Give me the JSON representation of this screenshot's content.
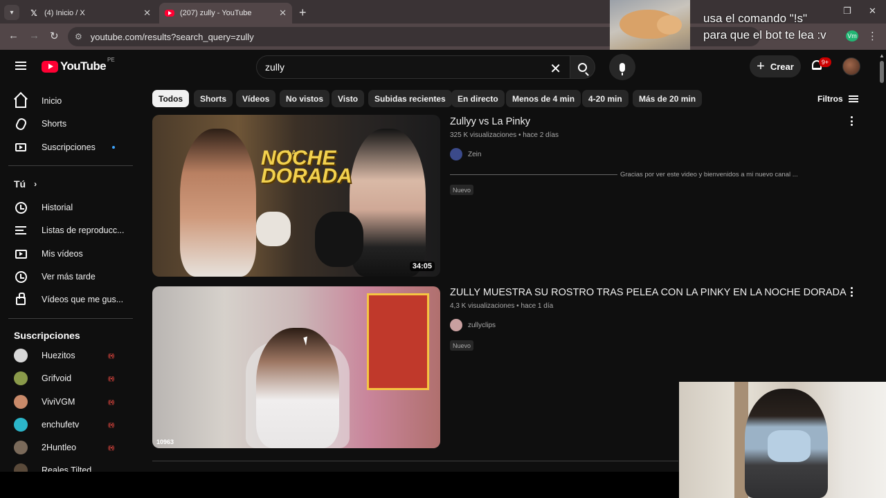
{
  "browser": {
    "tabs": [
      {
        "title": "(4) Inicio / X",
        "favicon": "x-icon",
        "active": false
      },
      {
        "title": "(207) zully - YouTube",
        "favicon": "youtube-icon",
        "active": true
      }
    ],
    "url": "youtube.com/results?search_query=zully"
  },
  "stream_overlay": {
    "text": "usa el comando \"!s\"\npara que el bot te lea :v",
    "badge": "Vm"
  },
  "header": {
    "logo_text": "YouTube",
    "country_code": "PE",
    "search_value": "zully",
    "create_label": "Crear",
    "notification_count": "9+"
  },
  "sidebar": {
    "main": [
      {
        "label": "Inicio",
        "icon": "home-icon"
      },
      {
        "label": "Shorts",
        "icon": "shorts-icon"
      },
      {
        "label": "Suscripciones",
        "icon": "subscriptions-icon"
      }
    ],
    "you_heading": "Tú",
    "you_items": [
      {
        "label": "Historial",
        "icon": "history-icon"
      },
      {
        "label": "Listas de reproducc...",
        "icon": "playlists-icon"
      },
      {
        "label": "Mis vídeos",
        "icon": "my-videos-icon"
      },
      {
        "label": "Ver más tarde",
        "icon": "watch-later-icon"
      },
      {
        "label": "Vídeos que me gus...",
        "icon": "liked-icon"
      }
    ],
    "subscriptions_heading": "Suscripciones",
    "subscriptions": [
      {
        "name": "Huezitos",
        "color": "#d8d8d8"
      },
      {
        "name": "Grifvoid",
        "color": "#8a9a4a"
      },
      {
        "name": "ViviVGM",
        "color": "#c98a6a"
      },
      {
        "name": "enchufetv",
        "color": "#2bb5c9"
      },
      {
        "name": "2Huntleo",
        "color": "#7a6a5a"
      },
      {
        "name": "Reales Tilted",
        "color": "#5a4a3a"
      }
    ]
  },
  "filters": {
    "chips": [
      "Todos",
      "Shorts",
      "Vídeos",
      "No vistos",
      "Visto",
      "Subidas recientes",
      "En directo",
      "Menos de 4 min",
      "4-20 min",
      "Más de 20 min"
    ],
    "active_chip": "Todos",
    "filters_label": "Filtros"
  },
  "results": [
    {
      "title": "Zullyy vs La Pinky",
      "views": "325 K visualizaciones",
      "age": "hace 2 días",
      "channel": "Zein",
      "channel_color": "#3b4a8a",
      "description": "Gracias por ver este video y bienvenidos a mi nuevo canal ...",
      "badge": "Nuevo",
      "duration": "34:05",
      "thumb_text_small": "LA",
      "thumb_text_large": "NOCHE DORADA"
    },
    {
      "title": "ZULLY MUESTRA SU ROSTRO TRAS PELEA CON LA PINKY EN LA NOCHE DORADA",
      "views": "4,3 K visualizaciones",
      "age": "hace 1 día",
      "channel": "zullyclips",
      "channel_color": "#c9a0a0",
      "badge": "Nuevo",
      "thumb_corner": "10963"
    }
  ]
}
